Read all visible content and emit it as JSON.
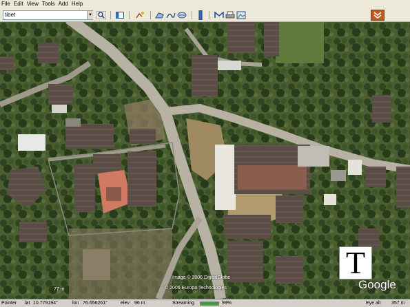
{
  "menubar": {
    "items": [
      "File",
      "Edit",
      "View",
      "Tools",
      "Add",
      "Help"
    ]
  },
  "toolbar": {
    "search_value": "tibet",
    "icons": [
      "dropdown-arrow-icon",
      "search-icon",
      "sidebar-icon",
      "placemark-icon",
      "polygon-icon",
      "path-icon",
      "overlay-icon",
      "ruler-icon",
      "email-icon",
      "print-icon",
      "photo-icon",
      "navigation-icon"
    ]
  },
  "map": {
    "copyright_line1": "Image © 2006 DigitalGlobe",
    "copyright_line2": "© 2006 Europa Technologies",
    "scale_label": "77 m",
    "logo_letter": "T",
    "google_logo": "Google"
  },
  "statusbar": {
    "pointer_label": "Pointer",
    "lat_label": "lat",
    "lat_value": "10.779194°",
    "lon_label": "lon",
    "lon_value": "76.656261°",
    "elev_label": "elev",
    "elev_value": "96 m",
    "streaming_label": "Streaming",
    "streaming_percent": "99%",
    "streaming_fraction": 0.99,
    "eye_alt_label": "Eye alt",
    "eye_alt_value": "357 m"
  },
  "colors": {
    "menubar_bg": "#ece9d8",
    "statusbar_bg": "#d4d0c8",
    "nav_button": "#c0581f",
    "progress_fill": "#3aa03a"
  }
}
